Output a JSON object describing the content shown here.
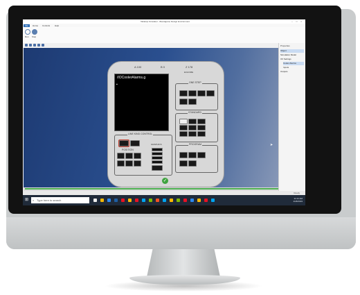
{
  "window": {
    "title": "Tabletop Simulator - Boardgame Design Environment",
    "controls": "–  □  ×"
  },
  "menu": {
    "items": [
      "File",
      "Home",
      "Controls",
      "Help"
    ]
  },
  "ribbon": {
    "run_label": "Run",
    "stop_label": "Stop"
  },
  "device": {
    "panel_top": [
      "A 100",
      "B 0",
      "Z 178"
    ],
    "screen_title": "/IOCoolerAlarms.g",
    "screen_cursor": "▪",
    "sections": {
      "line_kind": "LINE KIND CONTROL",
      "position": "POSITION",
      "graphics": "GRAPHICS",
      "one_step": "ONE STEP",
      "standard": "STANDARD",
      "program": "PROGRAM",
      "zoom": "ZOOM",
      "side_label": "ECHOME"
    }
  },
  "statusbar": {
    "text": "Ready"
  },
  "inspector": {
    "title": "Properties",
    "rows": [
      "Object",
      "Simulation Model",
      "I/O Settings",
      "Cooler Alarms",
      "Inputs",
      "Outputs"
    ]
  },
  "taskbar": {
    "search_placeholder": "Type here to search",
    "time": "11:24 AM",
    "date": "2/28/2019"
  },
  "colors": {
    "canvas_start": "#1d3a72",
    "canvas_end": "#9aa6bf",
    "status_ok": "#3fa33f",
    "accent": "#2a6bb5"
  },
  "icons": [
    "windows-start-icon",
    "search-icon",
    "check-circle-icon",
    "mouse-pointer-icon"
  ]
}
